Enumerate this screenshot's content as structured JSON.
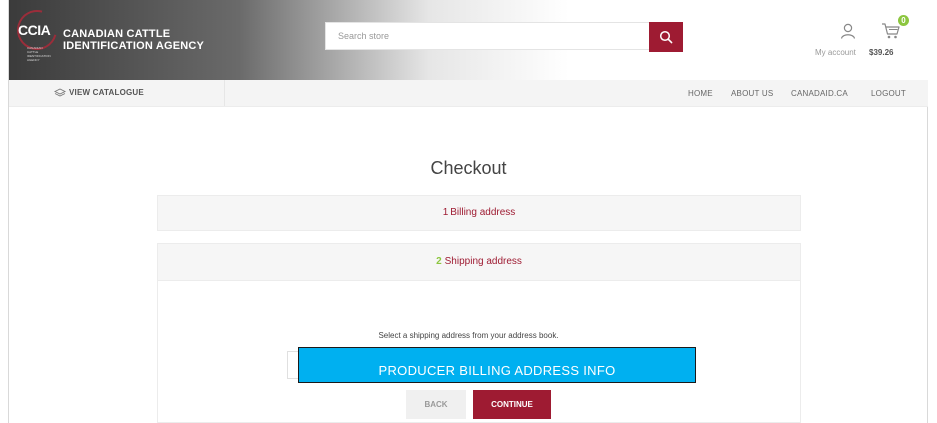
{
  "header": {
    "logo_abbr": "CCIA",
    "logo_tiny": "CANADIAN CATTLE IDENTIFICATION AGENCY",
    "brand_line1": "CANADIAN CATTLE",
    "brand_line2": "IDENTIFICATION AGENCY",
    "search_placeholder": "Search store",
    "account_label": "My account",
    "cart_total": "$39.26",
    "cart_count": "0",
    "icons": {
      "search": "search-icon",
      "account": "user-icon",
      "cart": "cart-icon"
    },
    "accent_color": "#9e1b32",
    "badge_color": "#8cc63f"
  },
  "nav": {
    "catalogue_label": "VIEW CATALOGUE",
    "links": [
      "HOME",
      "ABOUT US",
      "CANADAID.CA",
      "LOGOUT"
    ]
  },
  "checkout": {
    "title": "Checkout",
    "steps": [
      {
        "num": "1",
        "label": "Billing address"
      },
      {
        "num": "2",
        "label": "Shipping address"
      }
    ],
    "instruction": "Select a shipping address from your address book.",
    "select_overlay_text": "PRODUCER BILLING ADDRESS INFO",
    "back_label": "BACK",
    "continue_label": "CONTINUE"
  }
}
